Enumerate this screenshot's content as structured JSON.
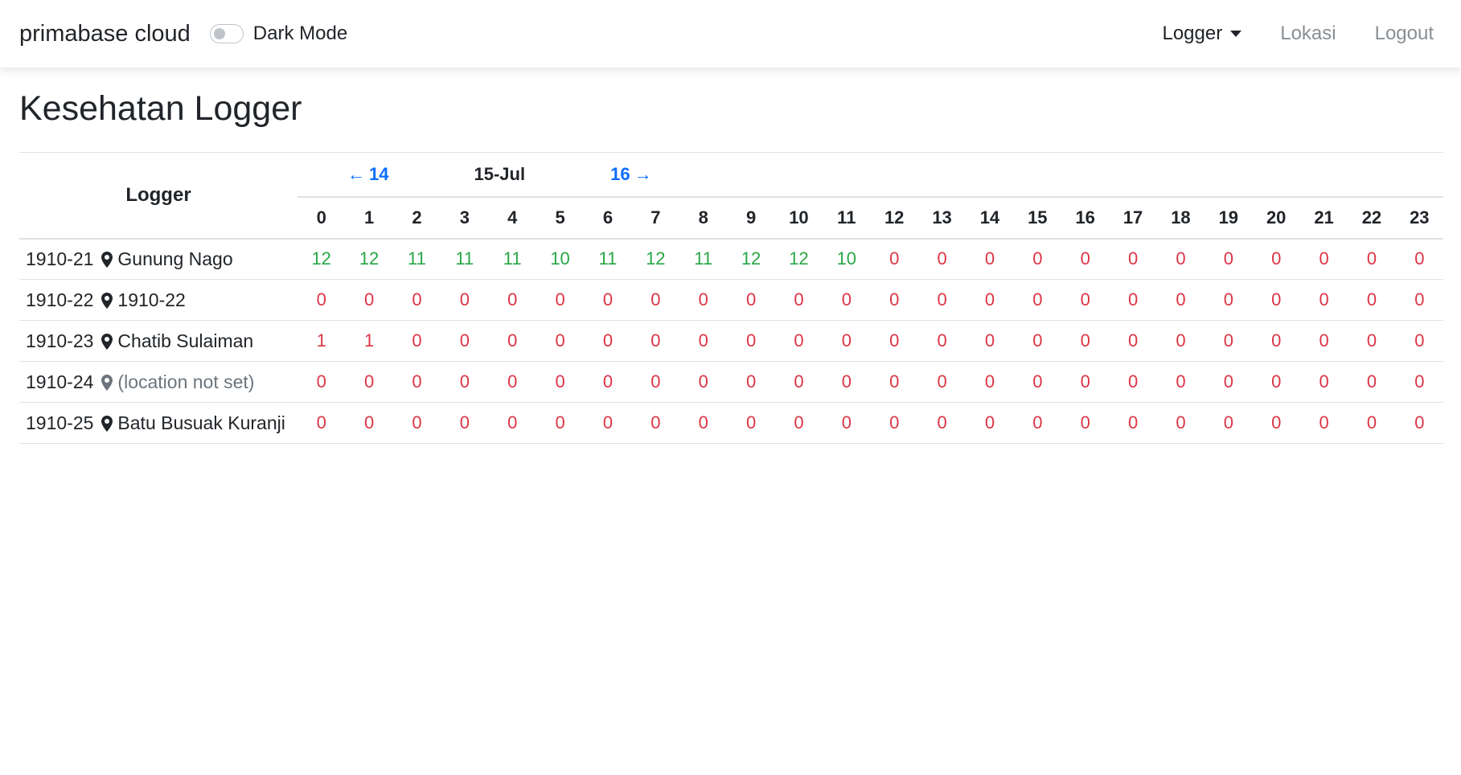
{
  "navbar": {
    "brand": "primabase cloud",
    "dark_mode_label": "Dark Mode",
    "dark_mode_on": false,
    "links": {
      "logger": "Logger",
      "lokasi": "Lokasi",
      "logout": "Logout"
    }
  },
  "page": {
    "title": "Kesehatan Logger"
  },
  "table": {
    "logger_header": "Logger",
    "date_nav": {
      "prev": "14",
      "current": "15-Jul",
      "next": "16"
    },
    "hours": [
      "0",
      "1",
      "2",
      "3",
      "4",
      "5",
      "6",
      "7",
      "8",
      "9",
      "10",
      "11",
      "12",
      "13",
      "14",
      "15",
      "16",
      "17",
      "18",
      "19",
      "20",
      "21",
      "22",
      "23"
    ],
    "rows": [
      {
        "id": "1910-21",
        "location": "Gunung Nago",
        "location_set": true,
        "values": [
          "12",
          "12",
          "11",
          "11",
          "11",
          "10",
          "11",
          "12",
          "11",
          "12",
          "12",
          "10",
          "0",
          "0",
          "0",
          "0",
          "0",
          "0",
          "0",
          "0",
          "0",
          "0",
          "0",
          "0"
        ]
      },
      {
        "id": "1910-22",
        "location": "1910-22",
        "location_set": true,
        "values": [
          "0",
          "0",
          "0",
          "0",
          "0",
          "0",
          "0",
          "0",
          "0",
          "0",
          "0",
          "0",
          "0",
          "0",
          "0",
          "0",
          "0",
          "0",
          "0",
          "0",
          "0",
          "0",
          "0",
          "0"
        ]
      },
      {
        "id": "1910-23",
        "location": "Chatib Sulaiman",
        "location_set": true,
        "values": [
          "1",
          "1",
          "0",
          "0",
          "0",
          "0",
          "0",
          "0",
          "0",
          "0",
          "0",
          "0",
          "0",
          "0",
          "0",
          "0",
          "0",
          "0",
          "0",
          "0",
          "0",
          "0",
          "0",
          "0"
        ]
      },
      {
        "id": "1910-24",
        "location": "(location not set)",
        "location_set": false,
        "values": [
          "0",
          "0",
          "0",
          "0",
          "0",
          "0",
          "0",
          "0",
          "0",
          "0",
          "0",
          "0",
          "0",
          "0",
          "0",
          "0",
          "0",
          "0",
          "0",
          "0",
          "0",
          "0",
          "0",
          "0"
        ]
      },
      {
        "id": "1910-25",
        "location": "Batu Busuak Kuranji",
        "location_set": true,
        "values": [
          "0",
          "0",
          "0",
          "0",
          "0",
          "0",
          "0",
          "0",
          "0",
          "0",
          "0",
          "0",
          "0",
          "0",
          "0",
          "0",
          "0",
          "0",
          "0",
          "0",
          "0",
          "0",
          "0",
          "0"
        ]
      }
    ]
  },
  "colors": {
    "good": "#28a745",
    "bad": "#dc3545",
    "link": "#0d6efd",
    "muted": "#6c757d"
  },
  "icons": {
    "location": "map-pin-icon",
    "prev": "arrow-left-icon",
    "next": "arrow-right-icon"
  }
}
